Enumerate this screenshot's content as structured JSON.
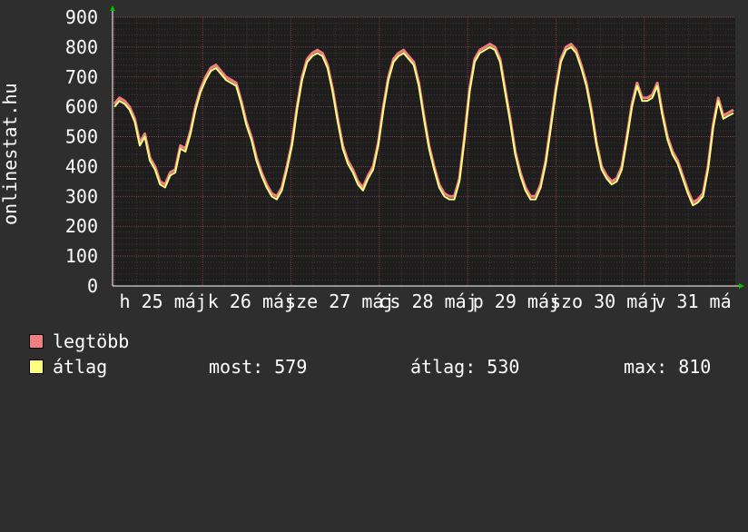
{
  "chart_data": {
    "type": "line",
    "vertical_label": "onlinestat.hu",
    "y_ticks": [
      0,
      100,
      200,
      300,
      400,
      500,
      600,
      700,
      800,
      900
    ],
    "ylim": [
      0,
      900
    ],
    "x_labels": [
      "h 25 máj",
      "k 26 máj",
      "sze 27 máj",
      "cs 28 máj",
      "p 29 máj",
      "szo 30 máj",
      "v 31 má"
    ],
    "x_label_count": 7,
    "grid": true,
    "legend_placement": "bottom-left",
    "background": "#2e2e2e",
    "plot_background": "#1e1e1e",
    "series": [
      {
        "name": "legtöbb",
        "color": "#f08080",
        "values": [
          610,
          630,
          620,
          600,
          560,
          480,
          510,
          430,
          400,
          350,
          340,
          380,
          390,
          470,
          460,
          520,
          600,
          660,
          700,
          730,
          740,
          720,
          700,
          690,
          680,
          620,
          550,
          500,
          430,
          380,
          340,
          310,
          300,
          330,
          400,
          480,
          600,
          700,
          760,
          780,
          790,
          780,
          740,
          660,
          560,
          470,
          420,
          390,
          350,
          330,
          370,
          400,
          480,
          600,
          700,
          760,
          780,
          790,
          770,
          750,
          680,
          570,
          470,
          400,
          340,
          310,
          300,
          300,
          360,
          500,
          660,
          760,
          790,
          800,
          810,
          800,
          760,
          660,
          560,
          450,
          380,
          330,
          300,
          300,
          340,
          420,
          540,
          660,
          760,
          800,
          810,
          790,
          740,
          680,
          590,
          480,
          400,
          370,
          350,
          360,
          400,
          500,
          610,
          680,
          630,
          630,
          640,
          680,
          580,
          500,
          450,
          420,
          370,
          320,
          280,
          290,
          310,
          400,
          540,
          630,
          570,
          580,
          590
        ]
      },
      {
        "name": "átlag",
        "color": "#ffff80",
        "values": [
          600,
          620,
          610,
          590,
          550,
          470,
          500,
          420,
          390,
          340,
          330,
          370,
          380,
          460,
          450,
          510,
          590,
          650,
          690,
          720,
          730,
          710,
          690,
          680,
          670,
          610,
          540,
          490,
          420,
          370,
          330,
          300,
          290,
          320,
          390,
          470,
          590,
          690,
          750,
          770,
          780,
          770,
          730,
          650,
          550,
          460,
          410,
          380,
          340,
          320,
          360,
          390,
          470,
          590,
          690,
          750,
          770,
          780,
          760,
          740,
          670,
          560,
          460,
          390,
          330,
          300,
          290,
          290,
          350,
          490,
          650,
          750,
          780,
          790,
          800,
          790,
          750,
          650,
          550,
          440,
          370,
          320,
          290,
          290,
          330,
          410,
          530,
          650,
          750,
          790,
          800,
          780,
          730,
          670,
          580,
          470,
          390,
          360,
          340,
          350,
          390,
          490,
          600,
          670,
          620,
          620,
          630,
          670,
          570,
          490,
          440,
          410,
          360,
          310,
          270,
          280,
          300,
          390,
          530,
          620,
          560,
          570,
          579
        ]
      }
    ]
  },
  "legend": {
    "items": [
      {
        "label": "legtöbb",
        "color": "#f08080"
      },
      {
        "label": "átlag",
        "color": "#ffff80"
      }
    ],
    "stats": {
      "now": "most: 579",
      "avg": "átlag: 530",
      "max": "max: 810"
    }
  }
}
